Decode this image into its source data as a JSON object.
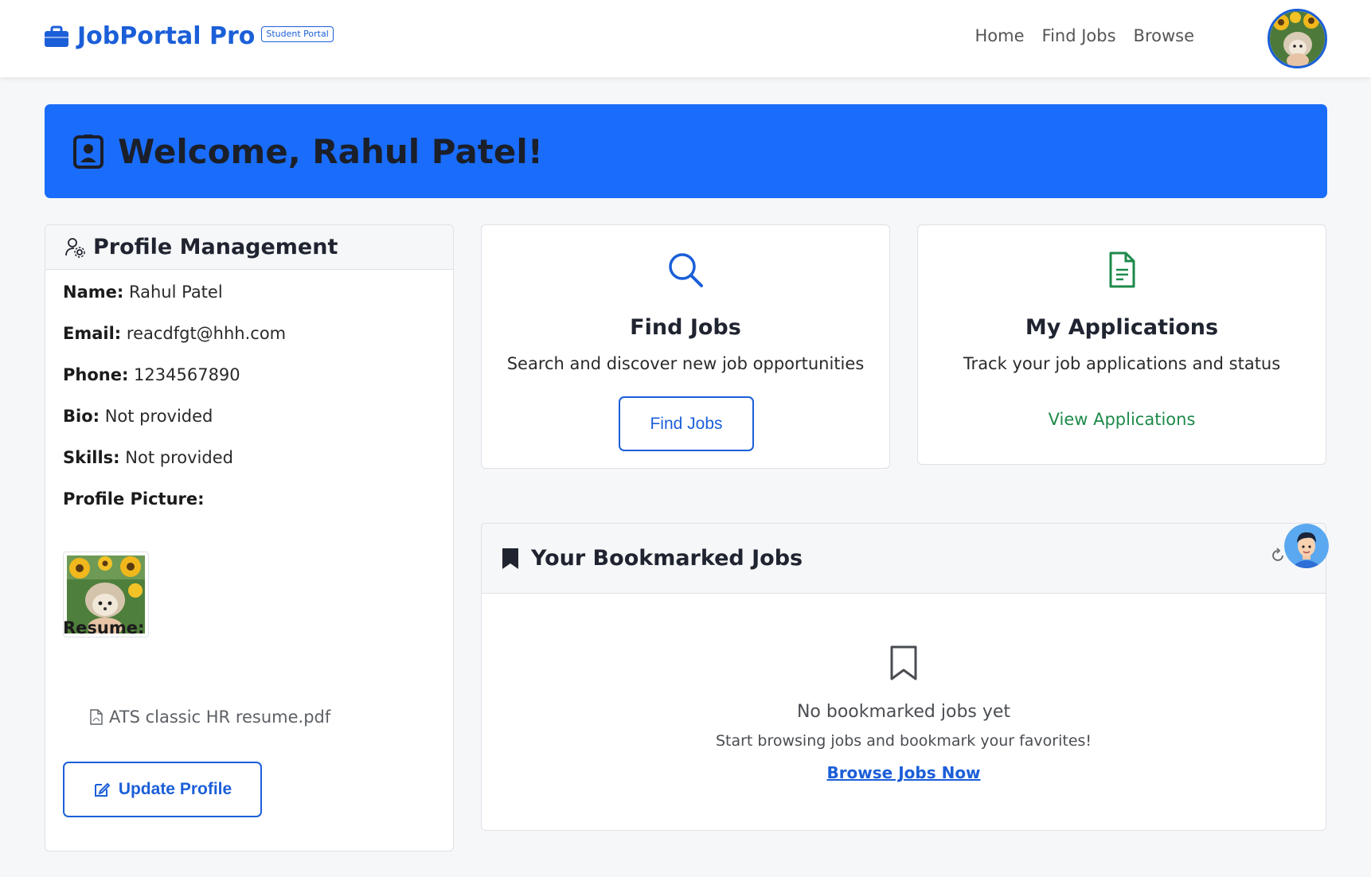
{
  "navbar": {
    "brand": "JobPortal Pro",
    "badge": "Student Portal",
    "links": [
      "Home",
      "Find Jobs",
      "Browse"
    ]
  },
  "banner": {
    "title": "Welcome, Rahul Patel!"
  },
  "profile": {
    "header": "Profile Management",
    "fields": [
      {
        "label": "Name:",
        "value": "Rahul Patel"
      },
      {
        "label": "Email:",
        "value": "reacdfgt@hhh.com"
      },
      {
        "label": "Phone:",
        "value": "1234567890"
      },
      {
        "label": "Bio:",
        "value": "Not provided"
      },
      {
        "label": "Skills:",
        "value": "Not provided"
      }
    ],
    "picture_label": "Profile Picture:",
    "resume_label": "Resume:",
    "resume_file": "ATS classic HR resume.pdf",
    "update_button": "Update Profile"
  },
  "find_jobs": {
    "title": "Find Jobs",
    "description": "Search and discover new job opportunities",
    "button": "Find Jobs"
  },
  "applications": {
    "title": "My Applications",
    "description": "Track your job applications and status",
    "link": "View Applications"
  },
  "bookmarks": {
    "header": "Your Bookmarked Jobs",
    "empty_title": "No bookmarked jobs yet",
    "empty_subtitle": "Start browsing jobs and bookmark your favorites!",
    "browse_link": "Browse Jobs Now"
  },
  "colors": {
    "primary": "#1b5fd8",
    "banner": "#1a6dfa",
    "success": "#1e8a4a"
  }
}
